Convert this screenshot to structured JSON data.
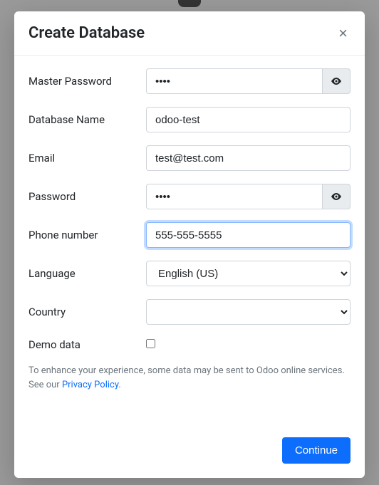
{
  "modal": {
    "title": "Create Database",
    "close": "×"
  },
  "fields": {
    "master_password": {
      "label": "Master Password",
      "value": "••••"
    },
    "database_name": {
      "label": "Database Name",
      "value": "odoo-test"
    },
    "email": {
      "label": "Email",
      "value": "test@test.com"
    },
    "password": {
      "label": "Password",
      "value": "••••"
    },
    "phone": {
      "label": "Phone number",
      "value": "555-555-5555"
    },
    "language": {
      "label": "Language",
      "selected": "English (US)"
    },
    "country": {
      "label": "Country",
      "selected": ""
    },
    "demo": {
      "label": "Demo data"
    }
  },
  "info": {
    "text_before": "To enhance your experience, some data may be sent to Odoo online services. See our ",
    "link": "Privacy Policy",
    "text_after": "."
  },
  "footer": {
    "continue": "Continue"
  },
  "icons": {
    "eye": "eye-icon"
  }
}
